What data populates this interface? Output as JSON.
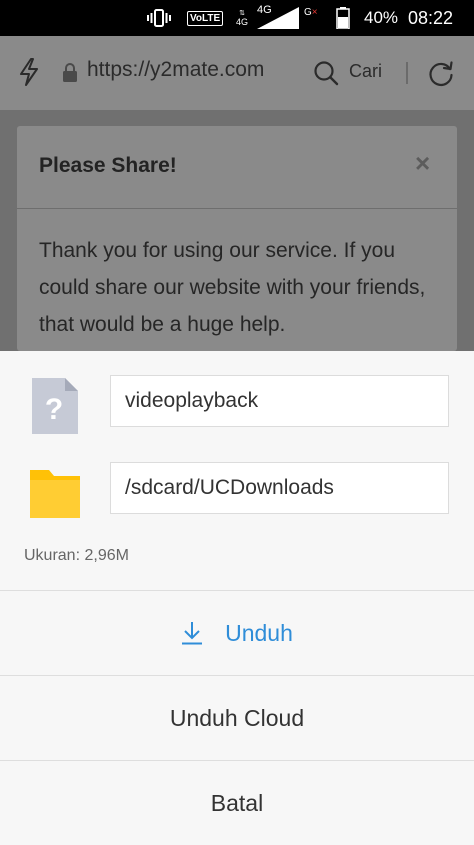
{
  "status_bar": {
    "volte": "VoLTE",
    "network_1": "4G",
    "network_2": "4G",
    "signal_2": "G",
    "signal_2_x": "×",
    "battery_percent": "40%",
    "time": "08:22"
  },
  "browser": {
    "url": "https://y2mate.com",
    "search_label": "Cari"
  },
  "dialog": {
    "title": "Please Share!",
    "close_symbol": "×",
    "message": "Thank you for using our service. If you could share our website with your friends, that would be a huge help."
  },
  "download_sheet": {
    "file_icon_symbol": "?",
    "filename": "videoplayback",
    "path": "/sdcard/UCDownloads",
    "size_text": "Ukuran: 2,96M",
    "download_label": "Unduh",
    "cloud_download_label": "Unduh Cloud",
    "cancel_label": "Batal"
  },
  "icons": {
    "vibrate": "vibrate-icon",
    "lightning": "lightning-icon",
    "lock": "lock-icon",
    "search": "search-icon",
    "refresh": "refresh-icon",
    "file": "file-unknown-icon",
    "folder": "folder-icon",
    "download": "download-icon"
  },
  "colors": {
    "accent": "#2f8dd8",
    "folder": "#ffc107",
    "sheet_bg": "#f7f7f7",
    "status_bg": "#000000"
  }
}
